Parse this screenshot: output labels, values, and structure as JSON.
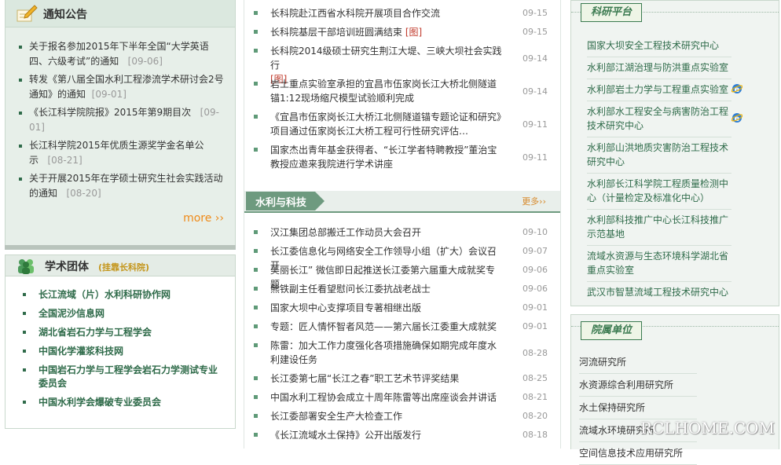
{
  "notice": {
    "title": "通知公告",
    "items": [
      {
        "text": "关于报名参加2015年下半年全国“大学英语四、六级考试”的通知",
        "date": "[09-06]"
      },
      {
        "text": "转发《第八届全国水利工程渗流学术研讨会2号通知》的通知",
        "date": "[09-01]"
      },
      {
        "text": "《长江科学院院报》2015年第9期目次",
        "date": "[09-01]"
      },
      {
        "text": "长江科学院2015年优质生源奖学金名单公示",
        "date": "[08-21]"
      },
      {
        "text": "关于开展2015年在学硕士研究生社会实践活动的通知",
        "date": "[08-20]"
      }
    ],
    "more": "more ››"
  },
  "assoc": {
    "title": "学术团体",
    "subtitle": "(挂靠长科院)",
    "items": [
      "长江流域（片）水利科研协作网",
      "全国泥沙信息网",
      "湖北省岩石力学与工程学会",
      "中国化学灌浆科技网",
      "中国岩石力学与工程学会岩石力学测试专业委员会",
      "中国水利学会爆破专业委员会"
    ]
  },
  "news_top": [
    {
      "text": "长科院赴江西省水科院开展项目合作交流",
      "tag": "",
      "date": "09-15"
    },
    {
      "text": "长科院基层干部培训班圆满结束",
      "tag": "[图]",
      "date": "09-15"
    },
    {
      "text": "长科院2014级硕士研究生荆江大堤、三峡大坝社会实践行",
      "tag": "[图]",
      "date": "09-14"
    },
    {
      "text": "岩土重点实验室承担的宜昌市伍家岗长江大桥北侧隧道锚1:12现场缩尺模型试验顺利完成",
      "tag": "",
      "date": "09-14"
    },
    {
      "text": "《宜昌市伍家岗长江大桥江北侧隧道锚专题论证和研究》项目通过伍家岗长江大桥工程可行性研究评估…",
      "tag": "",
      "date": "09-11"
    },
    {
      "text": "国家杰出青年基金获得者、“长江学者特聘教授”董治宝教授应邀来我院进行学术讲座",
      "tag": "",
      "date": "09-11"
    }
  ],
  "section": {
    "title": "水利与科技",
    "more": "更多››"
  },
  "news_bottom": [
    {
      "text": "汉江集团总部搬迁工作动员大会召开",
      "date": "09-10"
    },
    {
      "text": "长江委信息化与网络安全工作领导小组（扩大）会议召开",
      "date": "09-07"
    },
    {
      "text": "美丽长江” 微信即日起推送长江委第六届重大成就奖专题",
      "date": "09-06"
    },
    {
      "text": "熊铁副主任看望慰问长江委抗战老战士",
      "date": "09-06"
    },
    {
      "text": "国家大坝中心支撑项目专著相继出版",
      "date": "09-01"
    },
    {
      "text": "专题：匠人情怀智者风范——第六届长江委重大成就奖",
      "date": "09-01"
    },
    {
      "text": "陈雷：加大工作力度强化各项措施确保如期完成年度水利建设任务",
      "date": "08-28"
    },
    {
      "text": "长江委第七届“长江之春”职工艺术节评奖结果",
      "date": "08-25"
    },
    {
      "text": "中国水利工程协会成立十周年陈雷等出席座谈会并讲话",
      "date": "08-21"
    },
    {
      "text": "长江委部署安全生产大检查工作",
      "date": "08-20"
    },
    {
      "text": "《长江流域水土保持》公开出版发行",
      "date": "08-18"
    }
  ],
  "platform": {
    "title": "科研平台",
    "items": [
      {
        "text": "国家大坝安全工程技术研究中心",
        "ie": false
      },
      {
        "text": "水利部江湖治理与防洪重点实验室",
        "ie": false
      },
      {
        "text": "水利部岩土力学与工程重点实验室",
        "ie": true
      },
      {
        "text": "水利部水工程安全与病害防治工程技术研究中心",
        "ie": true
      },
      {
        "text": "水利部山洪地质灾害防治工程技术研究中心",
        "ie": false
      },
      {
        "text": "水利部长江科学院工程质量检测中心（计量检定及标准化中心）",
        "ie": false
      },
      {
        "text": "水利部科技推广中心长江科技推广示范基地",
        "ie": false
      },
      {
        "text": "流域水资源与生态环境科学湖北省重点实验室",
        "ie": false
      },
      {
        "text": "武汉市智慧流域工程技术研究中心",
        "ie": false
      }
    ]
  },
  "affiliates": {
    "title": "院属单位",
    "items": [
      "河流研究所",
      "水资源综合利用研究所",
      "水土保持研究所",
      "流域水环境研究所",
      "空间信息技术应用研究所"
    ]
  },
  "watermark": "RCLHOME.COM"
}
